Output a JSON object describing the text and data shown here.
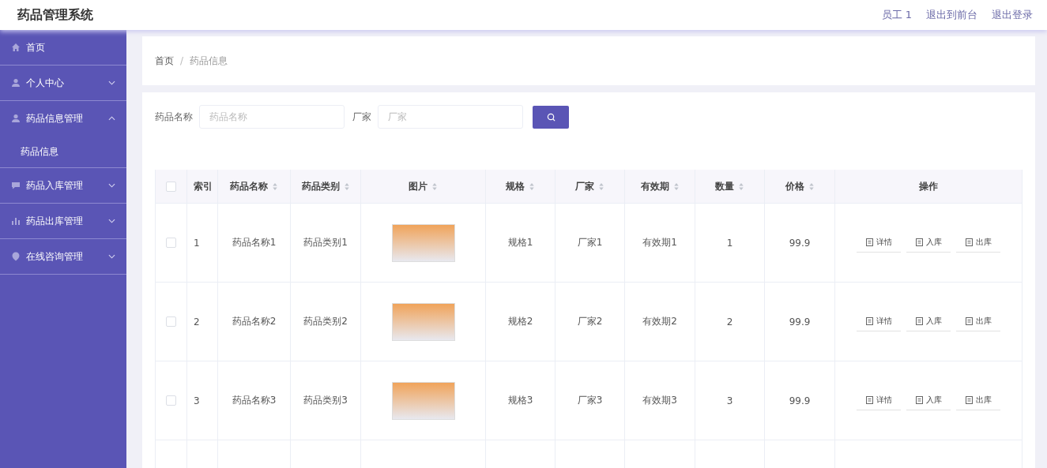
{
  "header": {
    "title": "药品管理系统",
    "links": [
      "员工 1",
      "退出到前台",
      "退出登录"
    ]
  },
  "sidebar": {
    "items": [
      {
        "label": "首页",
        "expandable": false
      },
      {
        "label": "个人中心",
        "expandable": true,
        "expanded": false
      },
      {
        "label": "药品信息管理",
        "expandable": true,
        "expanded": true,
        "children": [
          {
            "label": "药品信息"
          }
        ]
      },
      {
        "label": "药品入库管理",
        "expandable": true,
        "expanded": false
      },
      {
        "label": "药品出库管理",
        "expandable": true,
        "expanded": false
      },
      {
        "label": "在线咨询管理",
        "expandable": true,
        "expanded": false
      }
    ]
  },
  "breadcrumb": {
    "separator": "/",
    "items": [
      "首页",
      "药品信息"
    ]
  },
  "search": {
    "fields": [
      {
        "label": "药品名称",
        "placeholder": "药品名称"
      },
      {
        "label": "厂家",
        "placeholder": "厂家"
      }
    ]
  },
  "table": {
    "columns": [
      {
        "label": "索引",
        "sortable": false
      },
      {
        "label": "药品名称",
        "sortable": true
      },
      {
        "label": "药品类别",
        "sortable": true
      },
      {
        "label": "图片",
        "sortable": true
      },
      {
        "label": "规格",
        "sortable": true
      },
      {
        "label": "厂家",
        "sortable": true
      },
      {
        "label": "有效期",
        "sortable": true
      },
      {
        "label": "数量",
        "sortable": true
      },
      {
        "label": "价格",
        "sortable": true
      },
      {
        "label": "操作",
        "sortable": false
      }
    ],
    "all_checked": false,
    "rows": [
      {
        "checked": false,
        "cells": [
          "1",
          "药品名称1",
          "药品类别1",
          null,
          "规格1",
          "厂家1",
          "有效期1",
          "1",
          "99.9"
        ],
        "actions": [
          "详情",
          "入库",
          "出库"
        ]
      },
      {
        "checked": false,
        "cells": [
          "2",
          "药品名称2",
          "药品类别2",
          null,
          "规格2",
          "厂家2",
          "有效期2",
          "2",
          "99.9"
        ],
        "actions": [
          "详情",
          "入库",
          "出库"
        ]
      },
      {
        "checked": false,
        "cells": [
          "3",
          "药品名称3",
          "药品类别3",
          null,
          "规格3",
          "厂家3",
          "有效期3",
          "3",
          "99.9"
        ],
        "actions": [
          "详情",
          "入库",
          "出库"
        ]
      },
      {
        "partial": true
      }
    ]
  }
}
